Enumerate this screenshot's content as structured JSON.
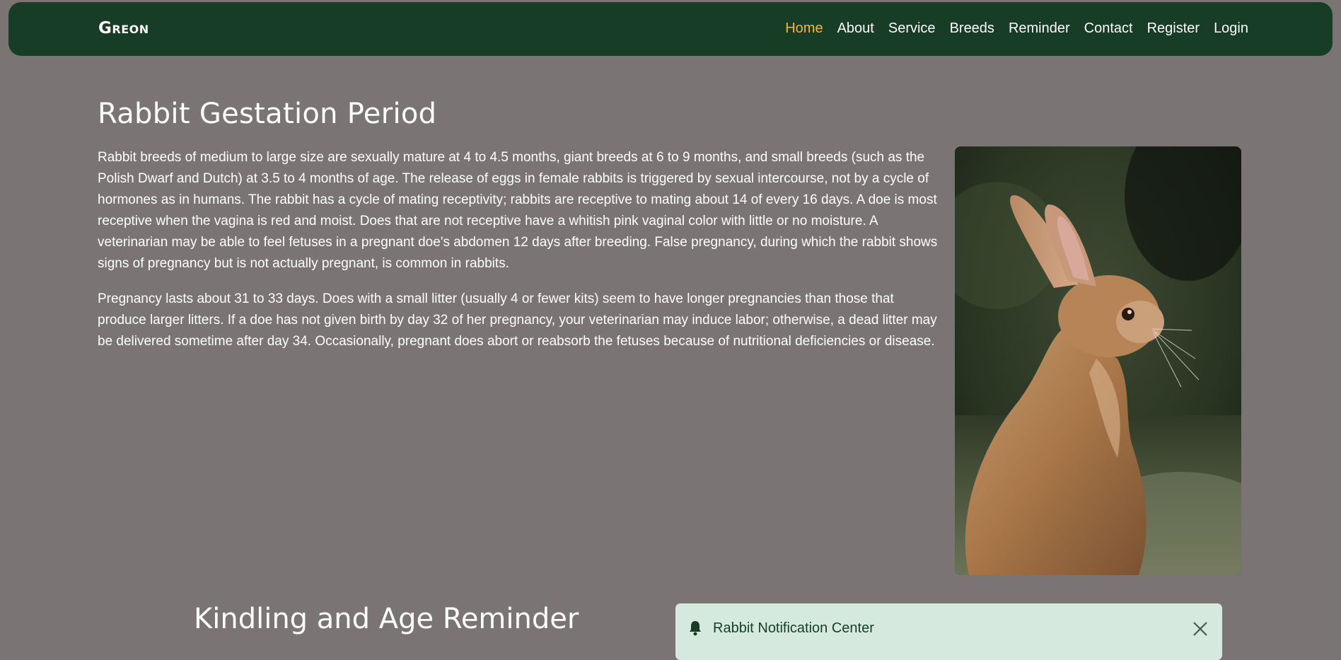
{
  "brand": {
    "name": "Greon"
  },
  "nav": {
    "items": [
      {
        "label": "Home",
        "active": true
      },
      {
        "label": "About"
      },
      {
        "label": "Service"
      },
      {
        "label": "Breeds"
      },
      {
        "label": "Reminder"
      },
      {
        "label": "Contact"
      },
      {
        "label": "Register"
      },
      {
        "label": "Login"
      }
    ],
    "active_color": "#f2b339"
  },
  "gestation": {
    "title": "Rabbit Gestation Period",
    "paragraphs": [
      "Rabbit breeds of medium to large size are sexually mature at 4 to 4.5 months, giant breeds at 6 to 9 months, and small breeds (such as the Polish Dwarf and Dutch) at 3.5 to 4 months of age. The release of eggs in female rabbits is triggered by sexual intercourse, not by a cycle of hormones as in humans. The rabbit has a cycle of mating receptivity; rabbits are receptive to mating about 14 of every 16 days. A doe is most receptive when the vagina is red and moist. Does that are not receptive have a whitish pink vaginal color with little or no moisture. A veterinarian may be able to feel fetuses in a pregnant doe's abdomen 12 days after breeding. False pregnancy, during which the rabbit shows signs of pregnancy but is not actually pregnant, is common in rabbits.",
      "Pregnancy lasts about 31 to 33 days. Does with a small litter (usually 4 or fewer kits) seem to have longer pregnancies than those that produce larger litters. If a doe has not given birth by day 32 of her pregnancy, your veterinarian may induce labor; otherwise, a dead litter may be delivered sometime after day 34. Occasionally, pregnant does abort or reabsorb the fetuses because of nutritional deficiencies or disease."
    ]
  },
  "reminder": {
    "title": "Kindling and Age Reminder"
  },
  "notification": {
    "title": "Rabbit Notification Center",
    "icon": "bell-icon",
    "close_icon": "close-icon"
  },
  "colors": {
    "background": "#7a7574",
    "navbar": "#173d26",
    "notification_bg": "#d5e9de"
  }
}
